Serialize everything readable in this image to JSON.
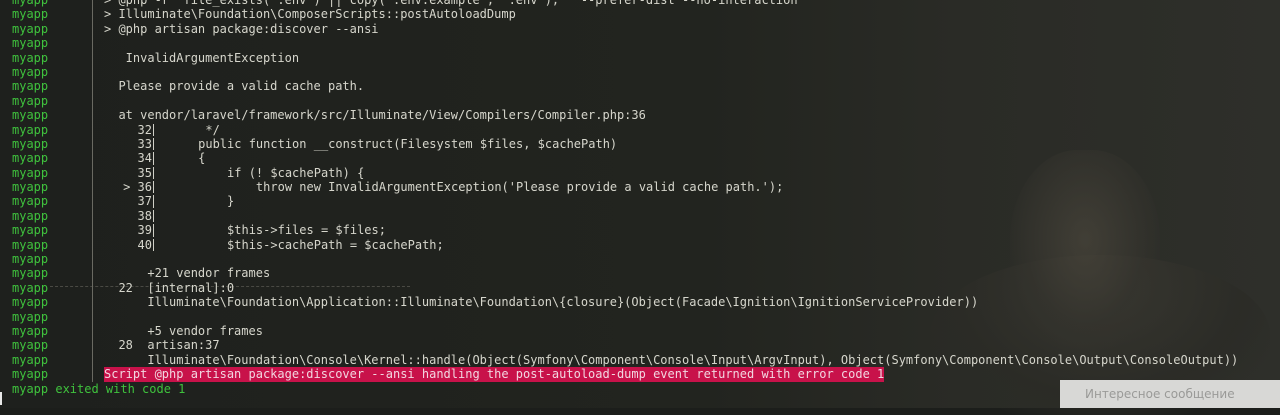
{
  "terminal": {
    "prefix": "myapp",
    "lines": [
      {
        "kind": "text",
        "content": "> @php -r \"file_exists('.env') || copy('.env.example', '.env');\"  --prefer-dist --no-interaction"
      },
      {
        "kind": "text",
        "content": "> Illuminate\\Foundation\\ComposerScripts::postAutoloadDump"
      },
      {
        "kind": "text",
        "content": "> @php artisan package:discover --ansi"
      },
      {
        "kind": "text",
        "content": ""
      },
      {
        "kind": "text",
        "content": "   InvalidArgumentException"
      },
      {
        "kind": "text",
        "content": ""
      },
      {
        "kind": "text",
        "content": "  Please provide a valid cache path."
      },
      {
        "kind": "text",
        "content": ""
      },
      {
        "kind": "text",
        "content": "  at vendor/laravel/framework/src/Illuminate/View/Compilers/Compiler.php:36"
      },
      {
        "kind": "code",
        "lno": "32",
        "code": "      */"
      },
      {
        "kind": "code",
        "lno": "33",
        "code": "     public function __construct(Filesystem $files, $cachePath)"
      },
      {
        "kind": "code",
        "lno": "34",
        "code": "     {"
      },
      {
        "kind": "code",
        "lno": "35",
        "code": "         if (! $cachePath) {"
      },
      {
        "kind": "code",
        "lno": "> 36",
        "code": "             throw new InvalidArgumentException('Please provide a valid cache path.');"
      },
      {
        "kind": "code",
        "lno": "37",
        "code": "         }"
      },
      {
        "kind": "code",
        "lno": "38",
        "code": ""
      },
      {
        "kind": "code",
        "lno": "39",
        "code": "         $this->files = $files;"
      },
      {
        "kind": "code",
        "lno": "40",
        "code": "         $this->cachePath = $cachePath;"
      },
      {
        "kind": "text",
        "content": ""
      },
      {
        "kind": "text",
        "content": "      +21 vendor frames"
      },
      {
        "kind": "text",
        "content": "  22  [internal]:0"
      },
      {
        "kind": "text",
        "content": "      Illuminate\\Foundation\\Application::Illuminate\\Foundation\\{closure}(Object(Facade\\Ignition\\IgnitionServiceProvider))"
      },
      {
        "kind": "text",
        "content": ""
      },
      {
        "kind": "text",
        "content": "      +5 vendor frames"
      },
      {
        "kind": "text",
        "content": "  28  artisan:37"
      },
      {
        "kind": "text",
        "content": "      Illuminate\\Foundation\\Console\\Kernel::handle(Object(Symfony\\Component\\Console\\Input\\ArgvInput), Object(Symfony\\Component\\Console\\Output\\ConsoleOutput))"
      },
      {
        "kind": "error",
        "content": "Script @php artisan package:discover --ansi handling the post-autoload-dump event returned with error code 1"
      }
    ],
    "exit_line": "myapp exited with code 1"
  },
  "background": {
    "card_text": "Интересное сообщение"
  },
  "colors": {
    "prefix": "#3fc23d",
    "error_bg": "#c8124a",
    "text": "#d6d6cc",
    "background": "#1c1e1b"
  }
}
